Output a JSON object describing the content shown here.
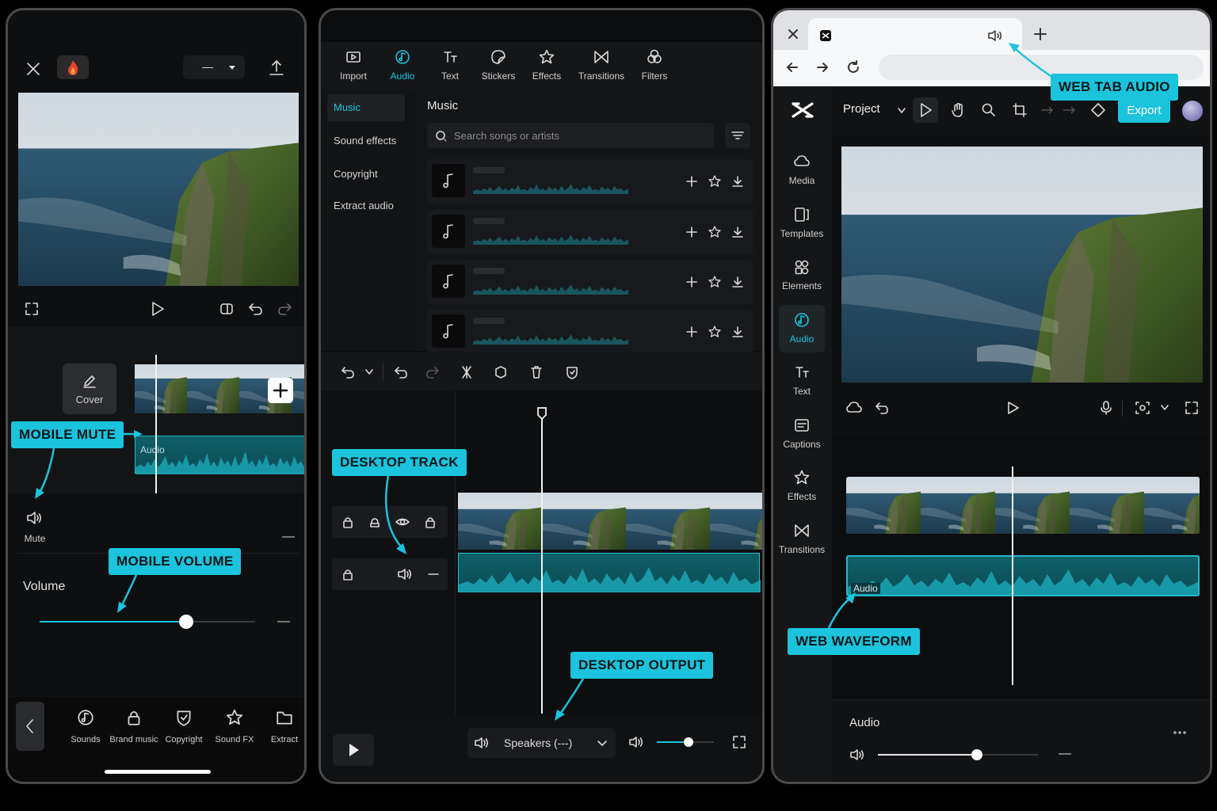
{
  "mobile": {
    "header": {
      "close_icon": "close-icon",
      "fire_icon": "fire-icon",
      "dropdown_value": "—",
      "export_icon": "upload-icon"
    },
    "preview_controls": {
      "fullscreen": "fullscreen-icon",
      "play": "play-icon",
      "keyframe": "keyframe-icon",
      "undo": "undo-icon",
      "redo": "redo-icon"
    },
    "cover_label": "Cover",
    "audio_track_label": "Audio",
    "mute_label": "Mute",
    "mute_value": "—",
    "volume_label": "Volume",
    "volume_value": "—",
    "volume_level": 0.68,
    "bottom_bar": [
      {
        "label": "Sounds",
        "icon": "music-note-icon"
      },
      {
        "label": "Brand music",
        "icon": "lock-icon"
      },
      {
        "label": "Copyright",
        "icon": "shield-check-icon"
      },
      {
        "label": "Sound FX",
        "icon": "star-icon"
      },
      {
        "label": "Extract",
        "icon": "folder-icon"
      }
    ]
  },
  "desktop": {
    "toolbar": [
      {
        "label": "Import",
        "icon": "import-icon"
      },
      {
        "label": "Audio",
        "icon": "audio-icon",
        "active": true
      },
      {
        "label": "Text",
        "icon": "text-icon"
      },
      {
        "label": "Stickers",
        "icon": "sticker-icon"
      },
      {
        "label": "Effects",
        "icon": "effects-icon"
      },
      {
        "label": "Transitions",
        "icon": "transitions-icon"
      },
      {
        "label": "Filters",
        "icon": "filters-icon"
      }
    ],
    "side_menu": [
      {
        "label": "Music",
        "active": true
      },
      {
        "label": "Sound effects"
      },
      {
        "label": "Copyright"
      },
      {
        "label": "Extract audio"
      }
    ],
    "music_title": "Music",
    "search_placeholder": "Search songs or artists",
    "speakers_label": "Speakers (---)",
    "output_volume_level": 0.55
  },
  "web": {
    "tab_icon": "capcut-logo",
    "tab_audio_icon": "speaker-icon",
    "project_label": "Project",
    "export_label": "Export",
    "sidebar": [
      {
        "label": "Media",
        "icon": "cloud-icon"
      },
      {
        "label": "Templates",
        "icon": "templates-icon"
      },
      {
        "label": "Elements",
        "icon": "elements-icon"
      },
      {
        "label": "Audio",
        "icon": "audio-icon",
        "active": true
      },
      {
        "label": "Text",
        "icon": "text-icon"
      },
      {
        "label": "Captions",
        "icon": "captions-icon"
      },
      {
        "label": "Effects",
        "icon": "effects-icon"
      },
      {
        "label": "Transitions",
        "icon": "transitions-icon"
      }
    ],
    "audio_track_label": "Audio",
    "audio_panel_title": "Audio",
    "audio_volume_value": "—",
    "audio_volume_level": 0.62,
    "more_icon": "more-icon"
  },
  "callouts": {
    "mobile_mute": "MOBILE MUTE",
    "mobile_volume": "MOBILE VOLUME",
    "desktop_track": "DESKTOP TRACK",
    "desktop_output": "DESKTOP OUTPUT",
    "web_tab_audio": "WEB TAB AUDIO",
    "web_waveform": "WEB WAVEFORM"
  },
  "colors": {
    "accent": "#1cc3dd",
    "waveform": "#0f5f68",
    "panel_bg": "#0e0f11"
  }
}
